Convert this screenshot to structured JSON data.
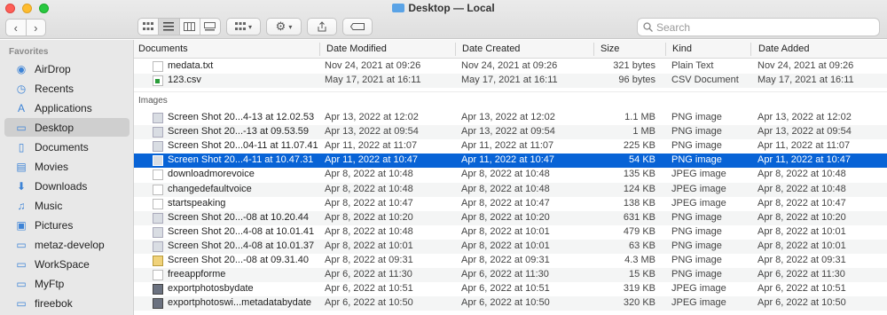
{
  "window": {
    "title": "Desktop — Local"
  },
  "toolbar": {
    "back": "‹",
    "forward": "›",
    "view_icons": [
      "icon-view-icon",
      "list-view-icon",
      "column-view-icon",
      "gallery-view-icon"
    ],
    "search_placeholder": "Search"
  },
  "sidebar": {
    "heading": "Favorites",
    "items": [
      {
        "label": "AirDrop",
        "icon": "airdrop-icon",
        "active": false
      },
      {
        "label": "Recents",
        "icon": "clock-icon",
        "active": false
      },
      {
        "label": "Applications",
        "icon": "applications-icon",
        "active": false
      },
      {
        "label": "Desktop",
        "icon": "desktop-icon",
        "active": true
      },
      {
        "label": "Documents",
        "icon": "document-icon",
        "active": false
      },
      {
        "label": "Movies",
        "icon": "film-icon",
        "active": false
      },
      {
        "label": "Downloads",
        "icon": "download-icon",
        "active": false
      },
      {
        "label": "Music",
        "icon": "music-icon",
        "active": false
      },
      {
        "label": "Pictures",
        "icon": "pictures-icon",
        "active": false
      },
      {
        "label": "metaz-develop",
        "icon": "folder-icon",
        "active": false
      },
      {
        "label": "WorkSpace",
        "icon": "folder-icon",
        "active": false
      },
      {
        "label": "MyFtp",
        "icon": "folder-icon",
        "active": false
      },
      {
        "label": "fireebok",
        "icon": "folder-icon",
        "active": false
      }
    ]
  },
  "columns": {
    "name": "Documents",
    "modified": "Date Modified",
    "created": "Date Created",
    "size": "Size",
    "kind": "Kind",
    "added": "Date Added"
  },
  "documents": [
    {
      "name": "medata.txt",
      "modified": "Nov 24, 2021 at 09:26",
      "created": "Nov 24, 2021 at 09:26",
      "size": "321 bytes",
      "kind": "Plain Text",
      "added": "Nov 24, 2021 at 09:26",
      "icon": "doc"
    },
    {
      "name": "123.csv",
      "modified": "May 17, 2021 at 16:11",
      "created": "May 17, 2021 at 16:11",
      "size": "96 bytes",
      "kind": "CSV Document",
      "added": "May 17, 2021 at 16:11",
      "icon": "csv"
    }
  ],
  "images_heading": "Images",
  "images": [
    {
      "name": "Screen Shot 20...4-13 at 12.02.53",
      "modified": "Apr 13, 2022 at 12:02",
      "created": "Apr 13, 2022 at 12:02",
      "size": "1.1 MB",
      "kind": "PNG image",
      "added": "Apr 13, 2022 at 12:02",
      "icon": "png"
    },
    {
      "name": "Screen Shot 20...-13 at 09.53.59",
      "modified": "Apr 13, 2022 at 09:54",
      "created": "Apr 13, 2022 at 09:54",
      "size": "1 MB",
      "kind": "PNG image",
      "added": "Apr 13, 2022 at 09:54",
      "icon": "png"
    },
    {
      "name": "Screen Shot 20...04-11 at 11.07.41",
      "modified": "Apr 11, 2022 at 11:07",
      "created": "Apr 11, 2022 at 11:07",
      "size": "225 KB",
      "kind": "PNG image",
      "added": "Apr 11, 2022 at 11:07",
      "icon": "png"
    },
    {
      "name": "Screen Shot 20...4-11 at 10.47.31",
      "modified": "Apr 11, 2022 at 10:47",
      "created": "Apr 11, 2022 at 10:47",
      "size": "54 KB",
      "kind": "PNG image",
      "added": "Apr 11, 2022 at 10:47",
      "icon": "png",
      "selected": true
    },
    {
      "name": "downloadmorevoice",
      "modified": "Apr 8, 2022 at 10:48",
      "created": "Apr 8, 2022 at 10:48",
      "size": "135 KB",
      "kind": "JPEG image",
      "added": "Apr 8, 2022 at 10:48",
      "icon": "doc"
    },
    {
      "name": "changedefaultvoice",
      "modified": "Apr 8, 2022 at 10:48",
      "created": "Apr 8, 2022 at 10:48",
      "size": "124 KB",
      "kind": "JPEG image",
      "added": "Apr 8, 2022 at 10:48",
      "icon": "doc"
    },
    {
      "name": "startspeaking",
      "modified": "Apr 8, 2022 at 10:47",
      "created": "Apr 8, 2022 at 10:47",
      "size": "138 KB",
      "kind": "JPEG image",
      "added": "Apr 8, 2022 at 10:47",
      "icon": "doc"
    },
    {
      "name": "Screen Shot 20...-08 at 10.20.44",
      "modified": "Apr 8, 2022 at 10:20",
      "created": "Apr 8, 2022 at 10:20",
      "size": "631 KB",
      "kind": "PNG image",
      "added": "Apr 8, 2022 at 10:20",
      "icon": "png"
    },
    {
      "name": "Screen Shot 20...4-08 at 10.01.41",
      "modified": "Apr 8, 2022 at 10:48",
      "created": "Apr 8, 2022 at 10:01",
      "size": "479 KB",
      "kind": "PNG image",
      "added": "Apr 8, 2022 at 10:01",
      "icon": "png"
    },
    {
      "name": "Screen Shot 20...4-08 at 10.01.37",
      "modified": "Apr 8, 2022 at 10:01",
      "created": "Apr 8, 2022 at 10:01",
      "size": "63 KB",
      "kind": "PNG image",
      "added": "Apr 8, 2022 at 10:01",
      "icon": "png"
    },
    {
      "name": "Screen Shot 20...-08 at 09.31.40",
      "modified": "Apr 8, 2022 at 09:31",
      "created": "Apr 8, 2022 at 09:31",
      "size": "4.3 MB",
      "kind": "PNG image",
      "added": "Apr 8, 2022 at 09:31",
      "icon": "jpg2"
    },
    {
      "name": "freeappforme",
      "modified": "Apr 6, 2022 at 11:30",
      "created": "Apr 6, 2022 at 11:30",
      "size": "15 KB",
      "kind": "PNG image",
      "added": "Apr 6, 2022 at 11:30",
      "icon": "doc"
    },
    {
      "name": "exportphotosbydate",
      "modified": "Apr 6, 2022 at 10:51",
      "created": "Apr 6, 2022 at 10:51",
      "size": "319 KB",
      "kind": "JPEG image",
      "added": "Apr 6, 2022 at 10:51",
      "icon": "jpg"
    },
    {
      "name": "exportphotoswi...metadatabydate",
      "modified": "Apr 6, 2022 at 10:50",
      "created": "Apr 6, 2022 at 10:50",
      "size": "320 KB",
      "kind": "JPEG image",
      "added": "Apr 6, 2022 at 10:50",
      "icon": "jpg"
    }
  ]
}
